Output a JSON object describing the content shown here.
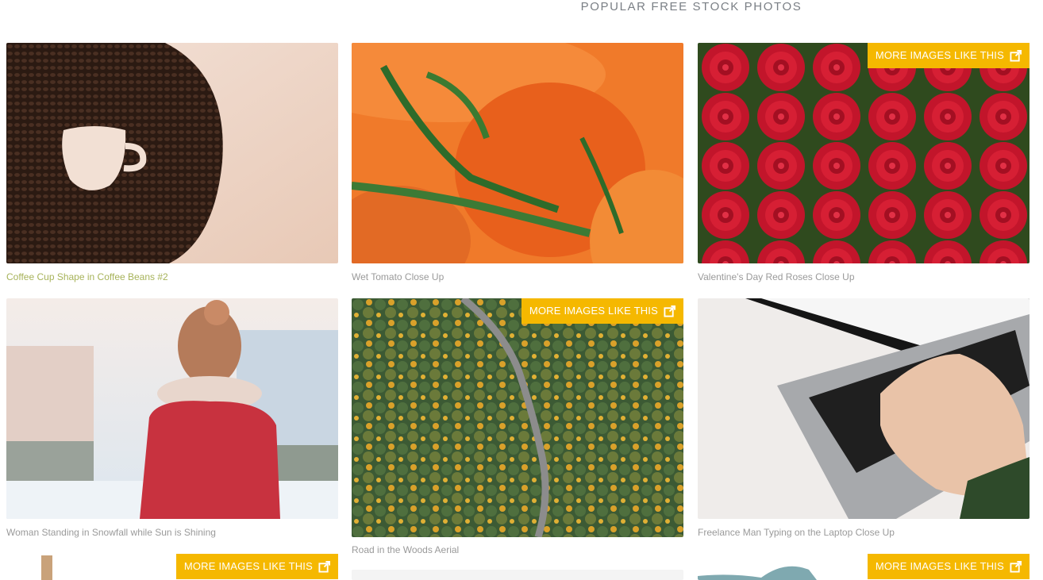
{
  "section": {
    "title": "POPULAR FREE STOCK PHOTOS"
  },
  "more_label": "MORE IMAGES LIKE THIS",
  "photos": [
    {
      "caption": "Coffee Cup Shape in Coffee Beans #2"
    },
    {
      "caption": "Wet Tomato Close Up"
    },
    {
      "caption": "Valentine's Day Red Roses Close Up"
    },
    {
      "caption": "Woman Standing in Snowfall while Sun is Shining"
    },
    {
      "caption": "Road in the Woods Aerial"
    },
    {
      "caption": "Freelance Man Typing on the Laptop Close Up"
    }
  ],
  "icons": {
    "external_link": "external-link-icon"
  },
  "colors": {
    "accent": "#f5b800",
    "caption": "#9a9a9a",
    "caption_highlight": "#a7b35a"
  }
}
